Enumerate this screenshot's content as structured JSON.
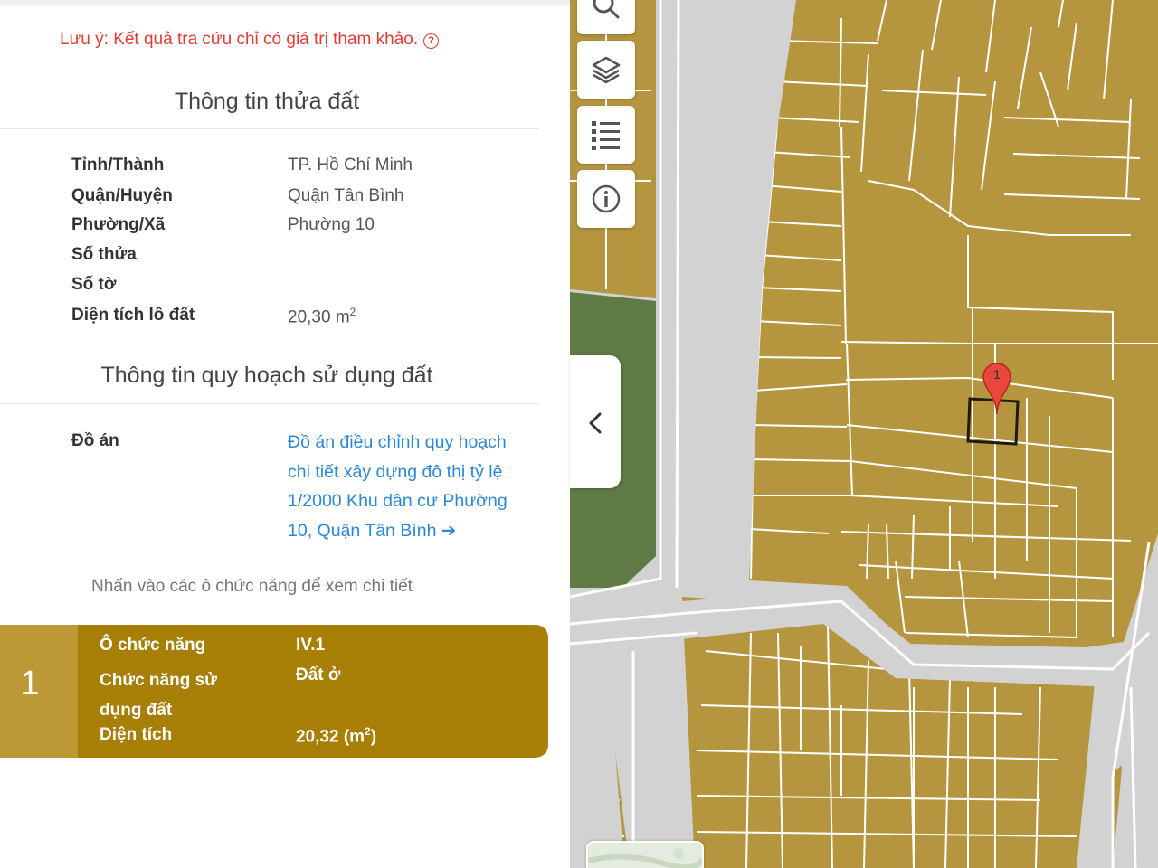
{
  "notice": {
    "text": "Lưu ý: Kết quả tra cứu chỉ có giá trị tham khảo.",
    "help_icon": "question-circle-icon"
  },
  "parcel_section": {
    "title": "Thông tin thửa đất",
    "rows": [
      {
        "label": "Tỉnh/Thành",
        "value": "TP. Hồ Chí Minh"
      },
      {
        "label": "Quận/Huyện",
        "value": "Quận Tân Bình"
      },
      {
        "label": "Phường/Xã",
        "value": "Phường 10"
      },
      {
        "label": "Số thửa",
        "value": ""
      },
      {
        "label": "Số tờ",
        "value": ""
      },
      {
        "label": "Diện tích lô đất",
        "value": "20,30 m",
        "unit_sup": "2"
      }
    ]
  },
  "planning_section": {
    "title": "Thông tin quy hoạch sử dụng đất",
    "project_label": "Đồ án",
    "project_link": "Đồ án điều chỉnh quy hoạch chi tiết xây dựng đô thị tỷ lệ 1/2000 Khu dân cư Phường 10, Quận Tân Bình",
    "project_link_icon": "arrow-right-icon",
    "hint": "Nhấn vào các ô chức năng để xem chi tiết"
  },
  "function_card": {
    "number": "1",
    "rows": [
      {
        "label": "Ô chức năng",
        "value": "IV.1"
      },
      {
        "label": "Chức năng sử dụng đất",
        "value": "Đất ở"
      },
      {
        "label": "Diện tích",
        "value": "20,32 (m",
        "unit_sup": "2",
        "unit_suffix": ")"
      }
    ],
    "color": "#a87f05",
    "number_bg": "#bd9837"
  },
  "map": {
    "controls": [
      "search-icon",
      "layers-icon",
      "list-icon",
      "info-icon"
    ],
    "collapse_icon": "chevron-left-icon",
    "marker_label": "1",
    "colors": {
      "residential": "#b5963f",
      "green": "#5f7a45",
      "road": "#d2d2d2",
      "parcel_line": "#ffffff",
      "marker": "#e8473d"
    }
  }
}
